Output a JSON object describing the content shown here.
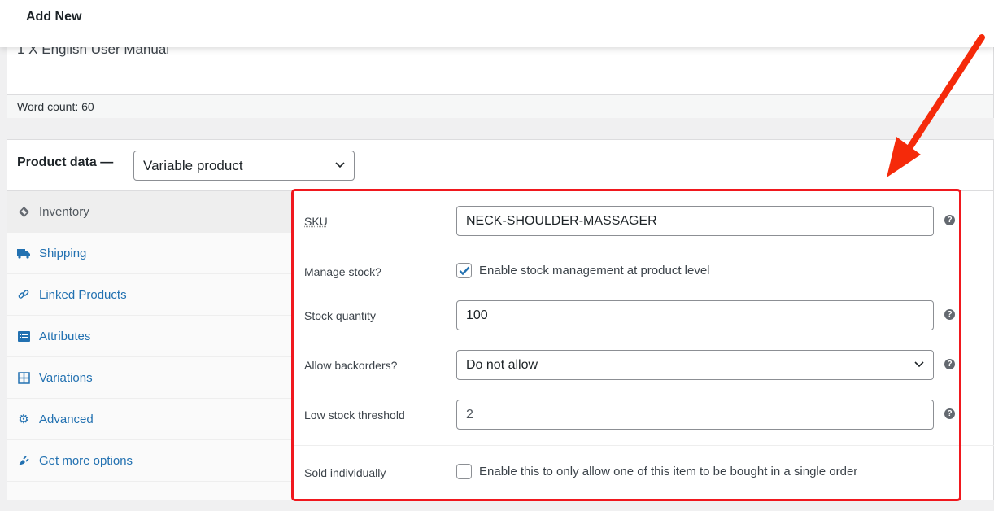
{
  "header": {
    "title": "Add New"
  },
  "editor": {
    "content_line": "1 X English User Manual",
    "word_count": "Word count: 60"
  },
  "product_data": {
    "label": "Product data —",
    "type_select": {
      "value": "Variable product"
    },
    "tabs": [
      {
        "label": "Inventory",
        "icon": "tag-icon",
        "active": true
      },
      {
        "label": "Shipping",
        "icon": "truck-icon",
        "active": false
      },
      {
        "label": "Linked Products",
        "icon": "link-icon",
        "active": false
      },
      {
        "label": "Attributes",
        "icon": "list-card-icon",
        "active": false
      },
      {
        "label": "Variations",
        "icon": "grid-icon",
        "active": false
      },
      {
        "label": "Advanced",
        "icon": "gear-icon",
        "active": false
      },
      {
        "label": "Get more options",
        "icon": "plugin-icon",
        "active": false
      }
    ],
    "inventory": {
      "sku": {
        "label": "SKU",
        "value": "NECK-SHOULDER-MASSAGER"
      },
      "manage_stock": {
        "label": "Manage stock?",
        "checkbox_label": "Enable stock management at product level",
        "checked": true
      },
      "stock_quantity": {
        "label": "Stock quantity",
        "value": "100"
      },
      "backorders": {
        "label": "Allow backorders?",
        "value": "Do not allow"
      },
      "low_stock": {
        "label": "Low stock threshold",
        "value": "2"
      },
      "sold_individually": {
        "label": "Sold individually",
        "checkbox_label": "Enable this to only allow one of this item to be bought in a single order",
        "checked": false
      },
      "help_glyph": "?"
    }
  },
  "annotation": {
    "color": "#f0181e"
  },
  "colors": {
    "link": "#2271b1",
    "accent_check": "#2271b1"
  }
}
